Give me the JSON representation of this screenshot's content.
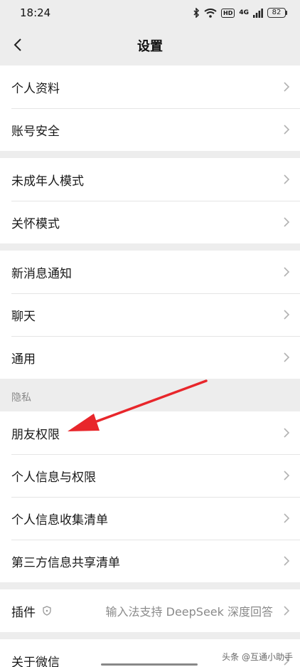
{
  "status_bar": {
    "time": "18:24",
    "hd_label": "HD",
    "network": "4G",
    "battery": "82"
  },
  "nav": {
    "title": "设置"
  },
  "groups": {
    "account": [
      "个人资料",
      "账号安全"
    ],
    "modes": [
      "未成年人模式",
      "关怀模式"
    ],
    "general": [
      "新消息通知",
      "聊天",
      "通用"
    ],
    "privacy": {
      "header": "隐私",
      "items": [
        "朋友权限",
        "个人信息与权限",
        "个人信息收集清单",
        "第三方信息共享清单"
      ]
    },
    "plugins": {
      "label": "插件",
      "value": "输入法支持 DeepSeek 深度回答"
    },
    "about": [
      "关于微信"
    ]
  },
  "watermark": "头条 @互通小助手",
  "annotation": {
    "arrow_color": "#e8262b"
  },
  "colors": {
    "background": "#ededed",
    "card": "#ffffff",
    "text": "#191919",
    "secondary": "#8a8a8a"
  }
}
